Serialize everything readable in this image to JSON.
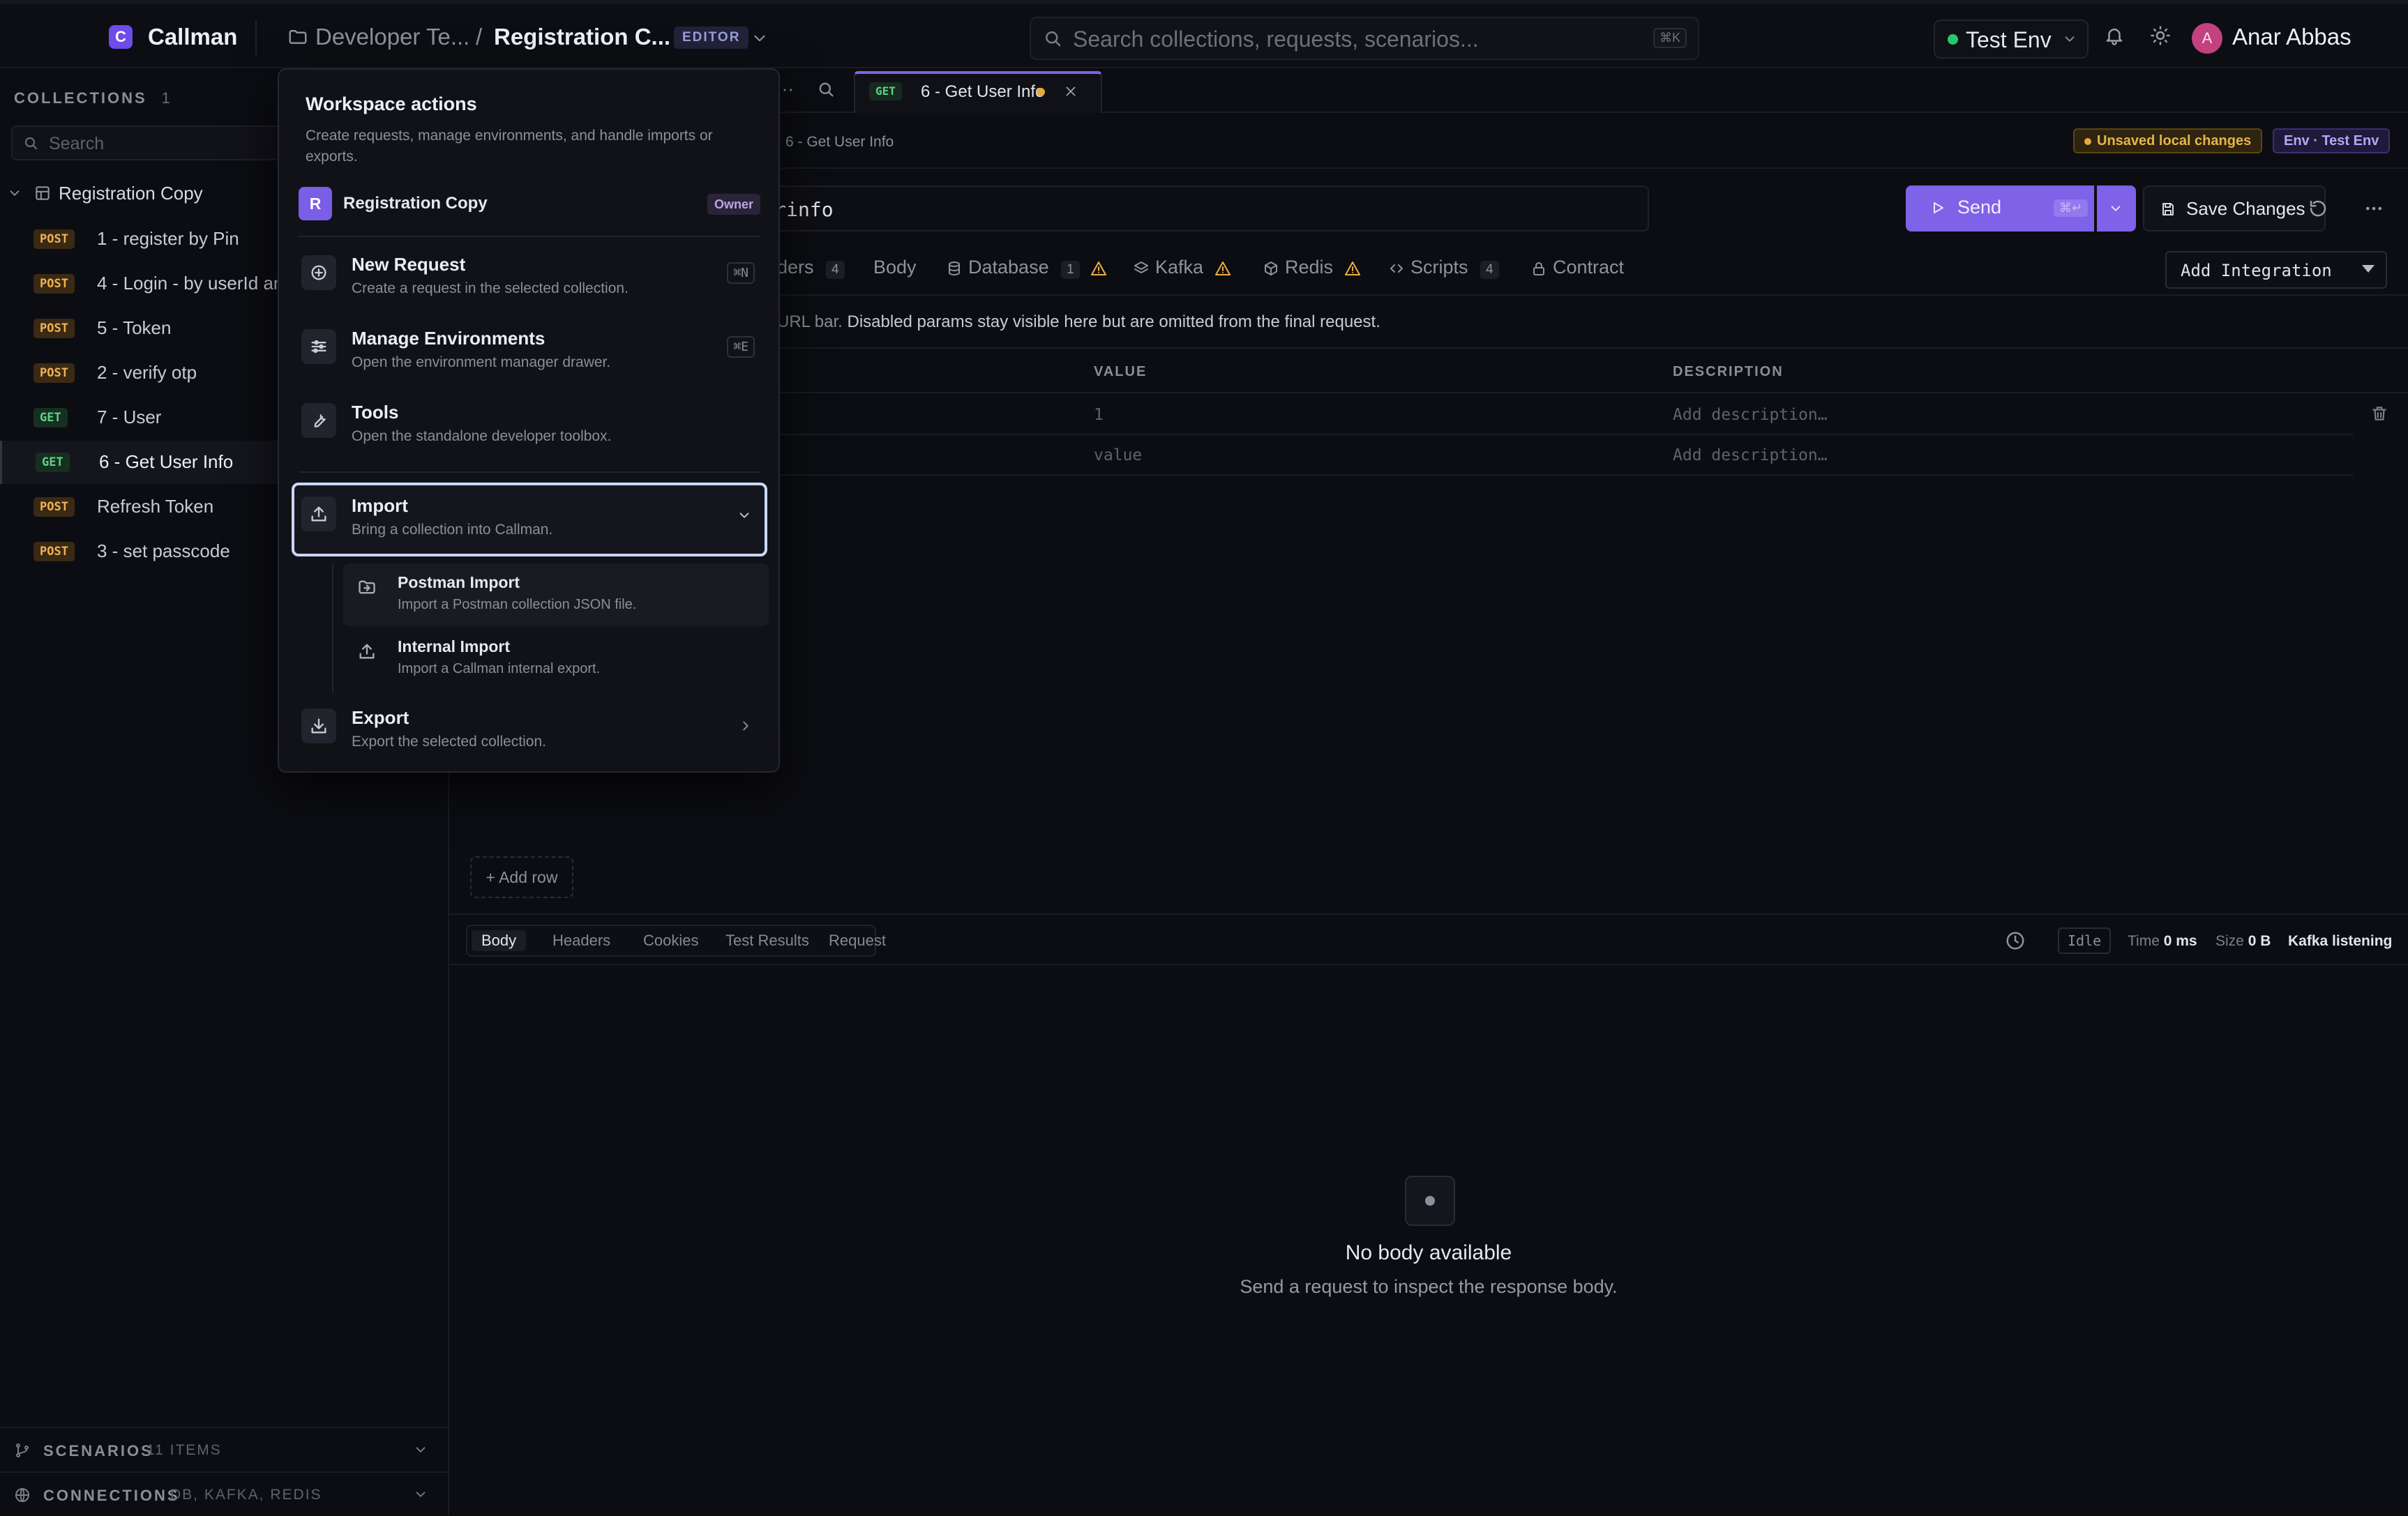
{
  "app": {
    "logo_letter": "C",
    "name": "Callman"
  },
  "header": {
    "breadcrumb_workspace": "Developer Te...",
    "breadcrumb_sep": "/",
    "breadcrumb_collection": "Registration C...",
    "mode_badge": "EDITOR",
    "search_placeholder": "Search collections, requests, scenarios...",
    "search_shortcut": "⌘K",
    "environment": "Test Env",
    "user_initial": "A",
    "user_name": "Anar Abbas"
  },
  "sidebar": {
    "collections_label": "COLLECTIONS",
    "collections_count": "1",
    "search_placeholder": "Search",
    "collection_name": "Registration Copy",
    "requests": [
      {
        "method": "POST",
        "name": "1 - register by Pin"
      },
      {
        "method": "POST",
        "name": "4 - Login - by userId and"
      },
      {
        "method": "POST",
        "name": "5 - Token"
      },
      {
        "method": "POST",
        "name": "2 - verify otp"
      },
      {
        "method": "GET",
        "name": "7 - User"
      },
      {
        "method": "GET",
        "name": "6 - Get User Info"
      },
      {
        "method": "POST",
        "name": "Refresh Token"
      },
      {
        "method": "POST",
        "name": "3 - set passcode"
      }
    ],
    "scenarios_label": "SCENARIOS",
    "scenarios_meta": "11 ITEMS",
    "connections_label": "CONNECTIONS",
    "connections_meta": "DB, KAFKA, REDIS"
  },
  "tab": {
    "method": "GET",
    "name": "6 - Get User Info",
    "overflow": "···"
  },
  "request": {
    "breadcrumb": "6 - Get User Info",
    "unsaved_label": "Unsaved local changes",
    "env_label": "Env · Test Env",
    "url_visible": "c/userinfo",
    "send_label": "Send",
    "send_shortcut": "⌘↵",
    "save_label": "Save Changes",
    "subtabs": {
      "headers": "ders",
      "headers_count": "4",
      "body": "Body",
      "database": "Database",
      "database_count": "1",
      "kafka": "Kafka",
      "redis": "Redis",
      "scripts": "Scripts",
      "scripts_count": "4",
      "contract": "Contract"
    },
    "add_integration": "Add Integration",
    "hint_prefix": "URL bar. ",
    "hint_text": "Disabled params stay visible here but are omitted from the final request.",
    "columns": {
      "value": "VALUE",
      "description": "DESCRIPTION"
    },
    "rows": [
      {
        "value": "1",
        "description_placeholder": "Add description…"
      },
      {
        "value": "value",
        "description_placeholder": "Add description…"
      }
    ],
    "add_row": "+ Add row"
  },
  "response": {
    "tabs": [
      "Body",
      "Headers",
      "Cookies",
      "Test Results",
      "Request"
    ],
    "status": "Idle",
    "time_label": "Time",
    "time_value": "0 ms",
    "size_label": "Size",
    "size_value": "0 B",
    "kafka_status": "Kafka listening",
    "empty_title": "No body available",
    "empty_desc": "Send a request to inspect the response body."
  },
  "popover": {
    "title": "Workspace actions",
    "description": "Create requests, manage environments, and handle imports or exports.",
    "workspace_initial": "R",
    "workspace_name": "Registration Copy",
    "role": "Owner",
    "items": [
      {
        "title": "New Request",
        "desc": "Create a request in the selected collection.",
        "shortcut": "⌘N",
        "icon": "plus-circle-icon"
      },
      {
        "title": "Manage Environments",
        "desc": "Open the environment manager drawer.",
        "shortcut": "⌘E",
        "icon": "sliders-icon"
      },
      {
        "title": "Tools",
        "desc": "Open the standalone developer toolbox.",
        "icon": "wrench-icon"
      },
      {
        "title": "Import",
        "desc": "Bring a collection into Callman.",
        "icon": "upload-icon"
      },
      {
        "title": "Export",
        "desc": "Export the selected collection.",
        "icon": "download-icon"
      }
    ],
    "import_sub": [
      {
        "title": "Postman Import",
        "desc": "Import a Postman collection JSON file."
      },
      {
        "title": "Internal Import",
        "desc": "Import a Callman internal export."
      }
    ]
  }
}
